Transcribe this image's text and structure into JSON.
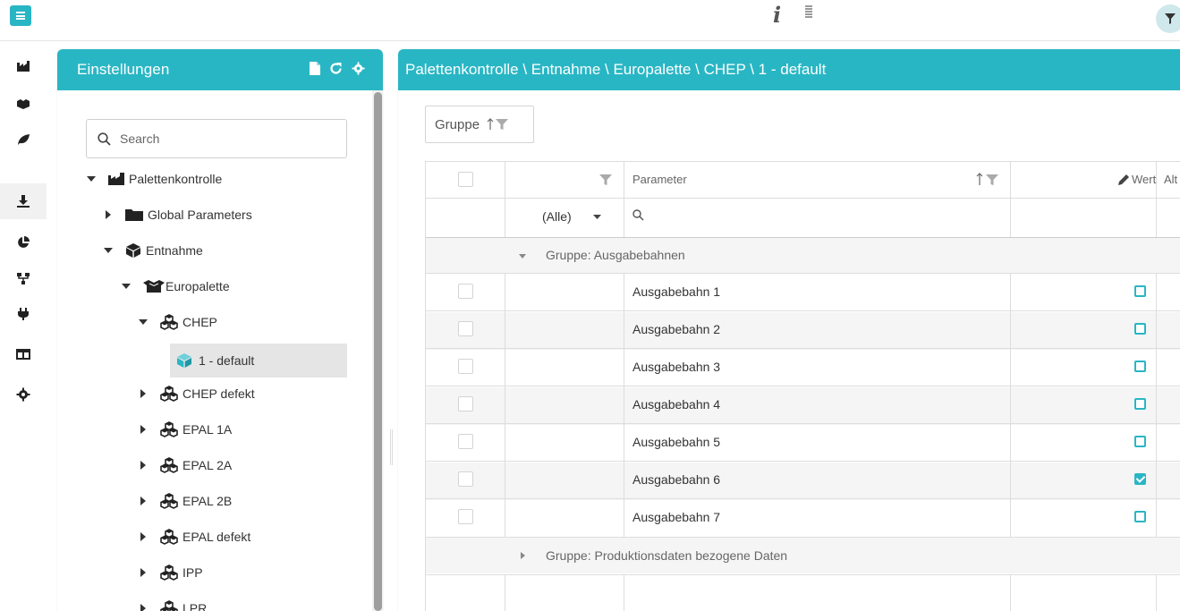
{
  "topbar": {
    "menu_icon": "hamburger-icon",
    "info_icon": "info-icon",
    "info_glyph": "i",
    "filter_icon": "filter-icon"
  },
  "leftnav": {
    "items": [
      {
        "icon": "factory-icon"
      },
      {
        "icon": "pallet-boxes-icon"
      },
      {
        "icon": "leaf-icon"
      },
      {
        "icon": "download-icon",
        "active": true
      },
      {
        "icon": "pie-chart-icon"
      },
      {
        "icon": "network-icon"
      },
      {
        "icon": "plug-icon"
      },
      {
        "icon": "columns-icon"
      },
      {
        "icon": "gear-icon"
      }
    ]
  },
  "tree_panel": {
    "title": "Einstellungen",
    "tools": [
      "file-icon",
      "refresh-icon",
      "gear-icon"
    ],
    "search_placeholder": "Search",
    "nodes": [
      {
        "label": "Palettenkontrolle",
        "level": 0,
        "expanded": true,
        "icon": "factory-icon"
      },
      {
        "label": "Global Parameters",
        "level": 1,
        "expanded": false,
        "icon": "folder-icon"
      },
      {
        "label": "Entnahme",
        "level": 1,
        "expanded": true,
        "icon": "cube-icon"
      },
      {
        "label": "Europalette",
        "level": 2,
        "expanded": true,
        "icon": "open-box-icon"
      },
      {
        "label": "CHEP",
        "level": 3,
        "expanded": true,
        "icon": "cubes-icon"
      },
      {
        "label": "1 - default",
        "level": 4,
        "selected": true,
        "icon": "cube-blue-icon"
      },
      {
        "label": "CHEP defekt",
        "level": 3,
        "expanded": false,
        "icon": "cubes-icon"
      },
      {
        "label": "EPAL 1A",
        "level": 3,
        "expanded": false,
        "icon": "cubes-icon"
      },
      {
        "label": "EPAL 2A",
        "level": 3,
        "expanded": false,
        "icon": "cubes-icon"
      },
      {
        "label": "EPAL 2B",
        "level": 3,
        "expanded": false,
        "icon": "cubes-icon"
      },
      {
        "label": "EPAL defekt",
        "level": 3,
        "expanded": false,
        "icon": "cubes-icon"
      },
      {
        "label": "IPP",
        "level": 3,
        "expanded": false,
        "icon": "cubes-icon"
      },
      {
        "label": "LPR",
        "level": 3,
        "expanded": false,
        "icon": "cubes-icon"
      }
    ]
  },
  "main_panel": {
    "breadcrumb": "Palettenkontrolle \\ Entnahme \\ Europalette \\ CHEP \\ 1 - default",
    "group_chip": "Gruppe",
    "columns": {
      "parameter": "Parameter",
      "wert": "Wert",
      "alt": "Alt"
    },
    "filter_select": "(Alle)",
    "groups": [
      {
        "label": "Gruppe: Ausgabebahnen",
        "expanded": true,
        "rows": [
          {
            "parameter": "Ausgabebahn 1",
            "wert": false
          },
          {
            "parameter": "Ausgabebahn 2",
            "wert": false
          },
          {
            "parameter": "Ausgabebahn 3",
            "wert": false
          },
          {
            "parameter": "Ausgabebahn 4",
            "wert": false
          },
          {
            "parameter": "Ausgabebahn 5",
            "wert": false
          },
          {
            "parameter": "Ausgabebahn 6",
            "wert": true
          },
          {
            "parameter": "Ausgabebahn 7",
            "wert": false
          }
        ]
      },
      {
        "label": "Gruppe: Produktionsdaten bezogene Daten",
        "expanded": false,
        "rows": []
      }
    ],
    "colors": {
      "accent": "#29b6c4"
    }
  }
}
